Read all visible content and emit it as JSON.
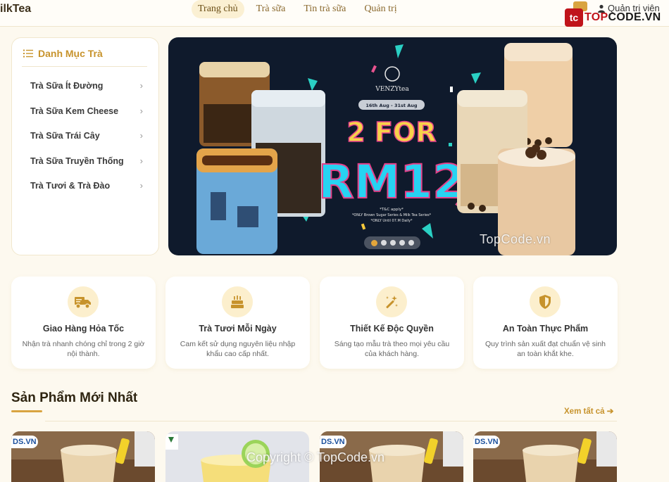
{
  "header": {
    "brand": "ilkTea",
    "nav": [
      {
        "label": "Trang chủ",
        "active": true
      },
      {
        "label": "Trà sữa",
        "active": false
      },
      {
        "label": "Tin trà sữa",
        "active": false
      },
      {
        "label": "Quản trị",
        "active": false
      }
    ],
    "admin_label": "Quản trị viên",
    "logo_tc": "tc",
    "logo_text_1": "TOP",
    "logo_text_2": "CODE.VN"
  },
  "categories": {
    "title": "Danh Mục Trà",
    "items": [
      {
        "label": "Trà Sữa Ít Đường"
      },
      {
        "label": "Trà Sữa Kem Cheese"
      },
      {
        "label": "Trà Sữa Trái Cây"
      },
      {
        "label": "Trà Sữa Truyền Thống"
      },
      {
        "label": "Trà Tươi & Trà Đào"
      }
    ],
    "chevron": "›"
  },
  "banner": {
    "brand": "VENZYtea",
    "date": "16th Aug - 31st Aug",
    "headline_1": "2 FOR",
    "headline_2": "RM12",
    "fine_print_1": "*T&C apply*",
    "fine_print_2": "*ONLY Brown Sugar Series & Milk Tea Series*",
    "fine_print_3": "*ONLY Until 07.M Daily*",
    "slides": 5,
    "active_slide": 1,
    "watermark": "TopCode.vn"
  },
  "features": [
    {
      "icon": "truck-icon",
      "title": "Giao Hàng Hỏa Tốc",
      "desc": "Nhận trà nhanh chóng chỉ trong 2 giờ nội thành."
    },
    {
      "icon": "cake-icon",
      "title": "Trà Tươi Mỗi Ngày",
      "desc": "Cam kết sử dụng nguyên liệu nhập khẩu cao cấp nhất."
    },
    {
      "icon": "magic-wand-icon",
      "title": "Thiết Kế Độc Quyền",
      "desc": "Sáng tạo mẫu trà theo mọi yêu cầu của khách hàng."
    },
    {
      "icon": "shield-icon",
      "title": "An Toàn Thực Phẩm",
      "desc": "Quy trình sản xuất đạt chuẩn vệ sinh an toàn khắt khe."
    }
  ],
  "new_products": {
    "title": "Sản Phẩm Mới Nhất",
    "see_all": "Xem tất cả",
    "badges": [
      "DS.VN",
      "",
      "DS.VN",
      "DS.VN"
    ]
  },
  "copyright": "Copyright © TopCode.vn",
  "colors": {
    "accent": "#d9a441",
    "accent_text": "#c7932c",
    "page_bg": "#fdf9ef",
    "banner_bg": "#0f1a2c"
  }
}
